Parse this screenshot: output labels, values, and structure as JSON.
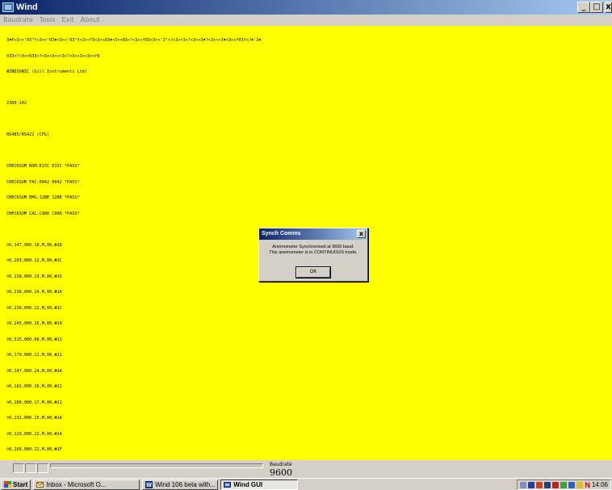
{
  "window": {
    "title": "Wind",
    "buttons": {
      "minimize": "_",
      "maximize": "□",
      "close": "x"
    }
  },
  "menu": [
    "Baudrate",
    "Tools",
    "Exit",
    "About"
  ],
  "terminal": {
    "lines": [
      "3♦F<3<<'03\"f<3<<'03♦<3<<'03\"f<3<<f3<3<<03♦<3<<03<?<3<<f03<3<<'3\"<?<3<•3<?<3<<3♦?<3<<•3♦<3<<f03f<?♦'3♦",
      "033<?<3<<033<?<3<<3<<•3<?<3<<3<<3<<f0",
      "WINDSONIC (Gill Instruments Ltd)",
      "",
      "2360-102",
      "",
      "RS485/RS422 (CFG)",
      "",
      "CHECKSUM ROM:E15C E15C *PASS*",
      "CHECKSUM FAC:0042 0042 *PASS*",
      "CHECKSUM EMG:12BE 12BE *PASS*",
      "CHECKSUM CAL:C980 C980 *PASS*",
      "",
      "☺0,147,000.10,M,00,☻1D",
      "☺0,203,000.12,M,00,☻1C",
      "☺0,138,000.23,M,00,☻15",
      "☺0,138,000.24,M,00,☻1A",
      "☺0,230,000.12,M,00,☻1C",
      "☺0,245,000.15,M,00,☻19",
      "☺0,315,000.08,M,00,☻11",
      "☺0,179,000.11,M,00,☻11",
      "☺0,147,000.24,M,00,☻1A",
      "☺0,182,000.26,M,00,☻11",
      "☺0,180,000.17,M,00,☻11",
      "☺0,132,000.15,M,00,☻1A",
      "☺0,129,000.22,M,00,☻14",
      "☺0,166,000.22,M,00,☻1F"
    ]
  },
  "dialog": {
    "title": "Synch Comms",
    "close": "x",
    "message_line1": "Anemometer Synchronised at 9600 baud.",
    "message_line2": "This anemometer is in CONTINUOUS mode.",
    "ok_label": "OK"
  },
  "status": {
    "baud_label": "Baudrate",
    "baud_value": "9600"
  },
  "taskbar": {
    "start_label": "Start",
    "tasks": [
      {
        "label": "Inbox - Microsoft O...",
        "icon": "outlook-icon",
        "active": false
      },
      {
        "label": "Wind 106 beta with...",
        "icon": "word-icon",
        "active": false
      },
      {
        "label": "Wind GUI",
        "icon": "app-icon",
        "active": true
      }
    ],
    "clock": "14:06"
  },
  "colors": {
    "terminal_bg": "#ffff00",
    "titlebar_start": "#0a246a",
    "titlebar_end": "#a6caf0"
  }
}
